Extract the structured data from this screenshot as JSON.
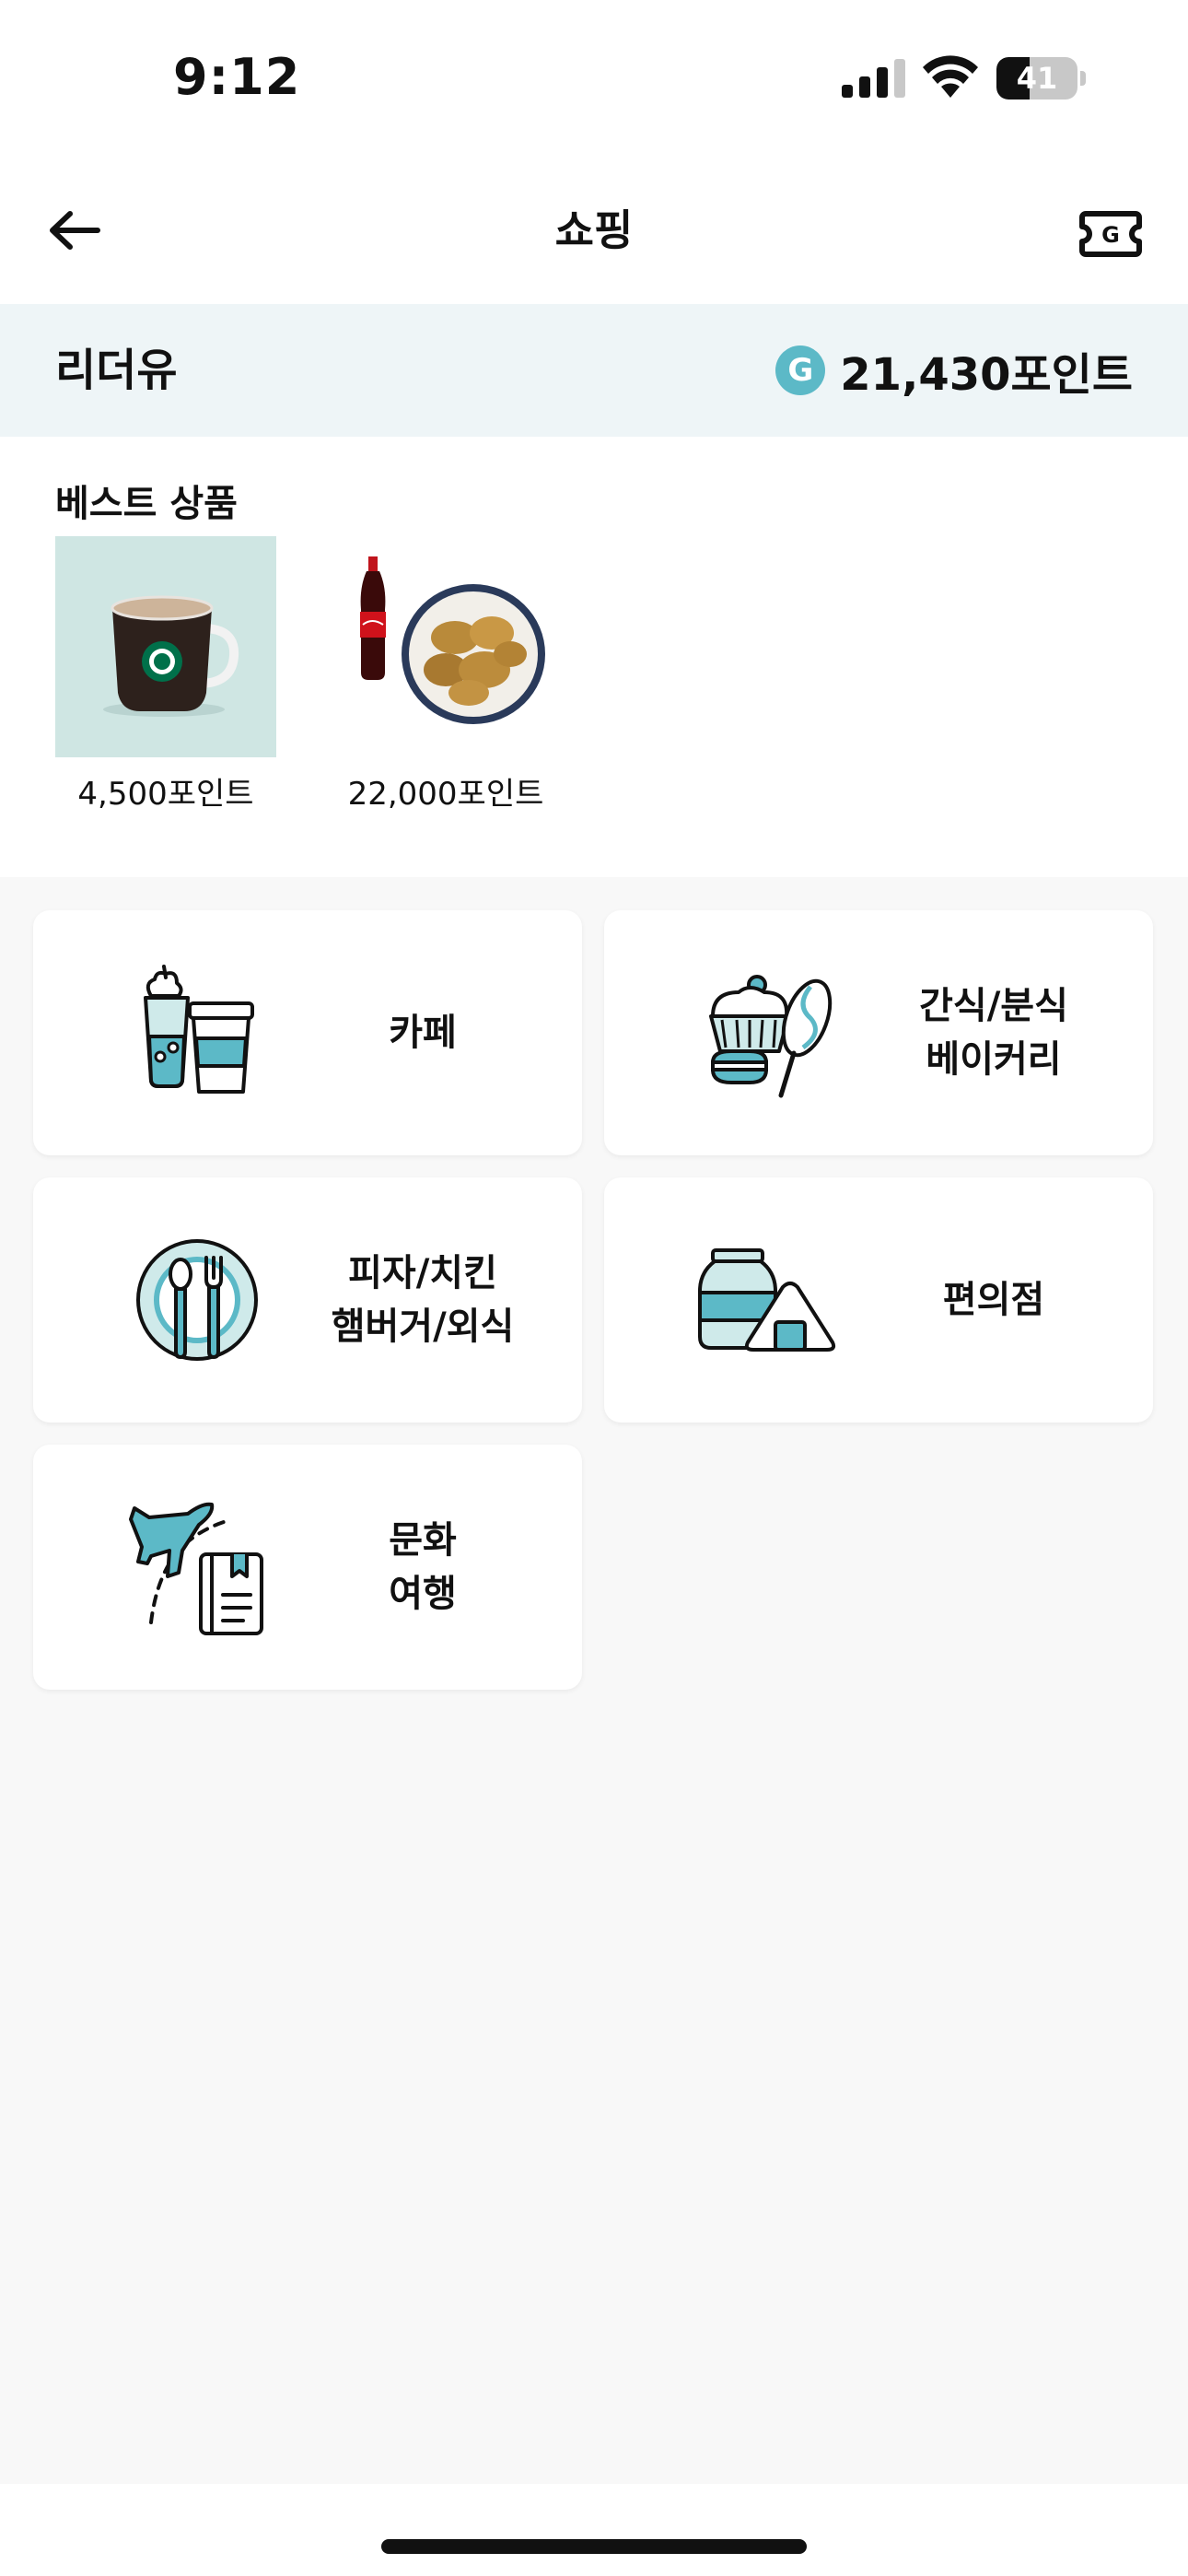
{
  "status_bar": {
    "time": "9:12",
    "battery_level": 41,
    "battery_text": "41"
  },
  "nav": {
    "title": "쇼핑",
    "back_icon": "arrow-left-icon",
    "ticket_icon": "g-ticket-icon"
  },
  "account": {
    "user_name": "리더유",
    "coin_symbol": "G",
    "points": "21,430포인트"
  },
  "best": {
    "title": "베스트 상품",
    "items": [
      {
        "price": "4,500포인트",
        "image": "coffee-mug"
      },
      {
        "price": "22,000포인트",
        "image": "chicken-and-cola"
      }
    ]
  },
  "categories": [
    {
      "icon": "cafe-drinks-icon",
      "line1": "카페",
      "line2": ""
    },
    {
      "icon": "snack-bakery-icon",
      "line1": "간식/분식",
      "line2": "베이커리"
    },
    {
      "icon": "dining-utensils-icon",
      "line1": "피자/치킨",
      "line2": "햄버거/외식"
    },
    {
      "icon": "convenience-store-icon",
      "line1": "편의점",
      "line2": ""
    },
    {
      "icon": "culture-travel-icon",
      "line1": "문화",
      "line2": "여행"
    }
  ],
  "colors": {
    "accent": "#5cb9c7",
    "band": "#eef5f7",
    "background": "#f8f8f8"
  }
}
